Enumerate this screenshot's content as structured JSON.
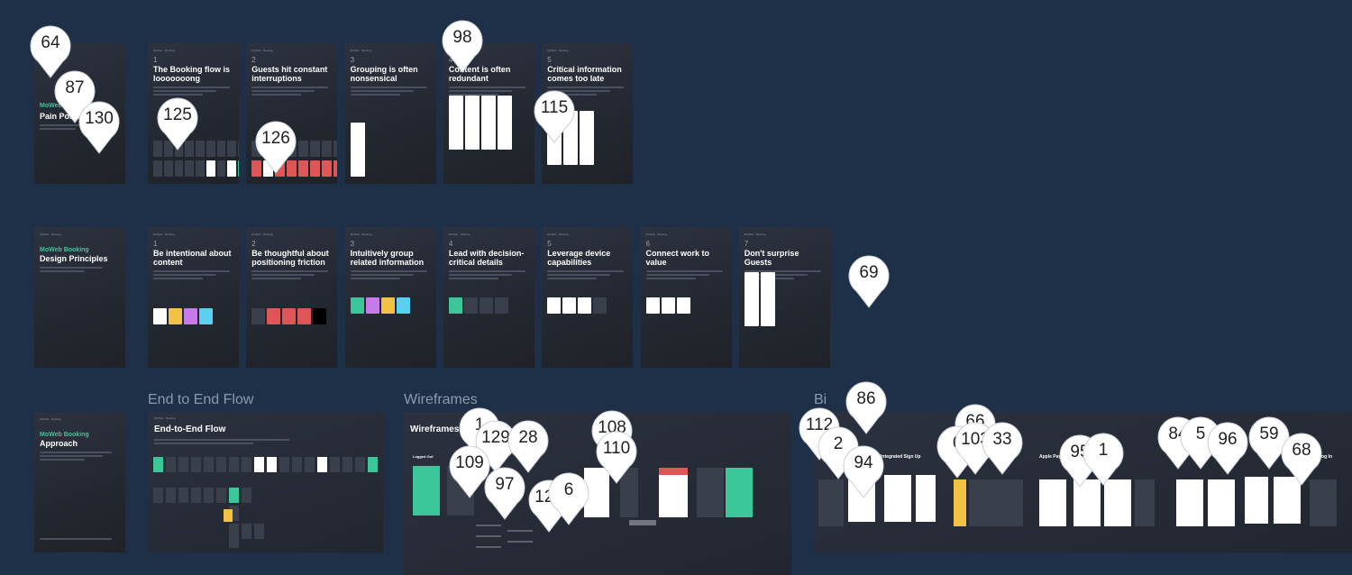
{
  "row1": {
    "intro": {
      "kicker": "MoWeb Booking",
      "title": "Pain Points Today"
    },
    "cards": [
      {
        "num": "1",
        "title": "The Booking flow is looooooong"
      },
      {
        "num": "2",
        "title": "Guests hit constant interruptions"
      },
      {
        "num": "3",
        "title": "Grouping is often nonsensical"
      },
      {
        "num": "4",
        "title": "Content is often redundant"
      },
      {
        "num": "5",
        "title": "Critical information comes too late"
      }
    ]
  },
  "row2": {
    "intro": {
      "kicker": "MoWeb Booking",
      "title": "Design Principles"
    },
    "cards": [
      {
        "num": "1",
        "title": "Be intentional about content"
      },
      {
        "num": "2",
        "title": "Be thoughtful about positioning friction"
      },
      {
        "num": "3",
        "title": "Intuitively group related information"
      },
      {
        "num": "4",
        "title": "Lead with decision-critical details"
      },
      {
        "num": "5",
        "title": "Leverage device capabilities"
      },
      {
        "num": "6",
        "title": "Connect work to value"
      },
      {
        "num": "7",
        "title": "Don't surprise Guests"
      }
    ]
  },
  "row3": {
    "intro": {
      "kicker": "MoWeb Booking",
      "title": "Approach"
    },
    "sections": {
      "end_to_end": "End to End Flow",
      "wireframes": "Wireframes",
      "big": "Bi"
    },
    "panels": {
      "end_to_end_title": "End-to-End Flow",
      "wireframes_title": "Wireframes"
    },
    "panel_labels": {
      "logged_out": "Logged Out",
      "integrated_signup": "Integrated Sign Up",
      "apple_pay": "Apple Pay",
      "log_in": "Log In"
    }
  },
  "pins": [
    "64",
    "87",
    "130",
    "125",
    "126",
    "98",
    "115",
    "69",
    "86",
    "112",
    "2",
    "94",
    "66",
    "6",
    "103",
    "33",
    "95",
    "1",
    "84",
    "5",
    "96",
    "59",
    "68",
    "108",
    "110",
    "1",
    "129",
    "28",
    "109",
    "97",
    "127",
    "6"
  ],
  "colors": {
    "background": "#1e3047",
    "card": "#262a33",
    "accent_green": "#3cc79a",
    "pin": "#ffffff"
  }
}
